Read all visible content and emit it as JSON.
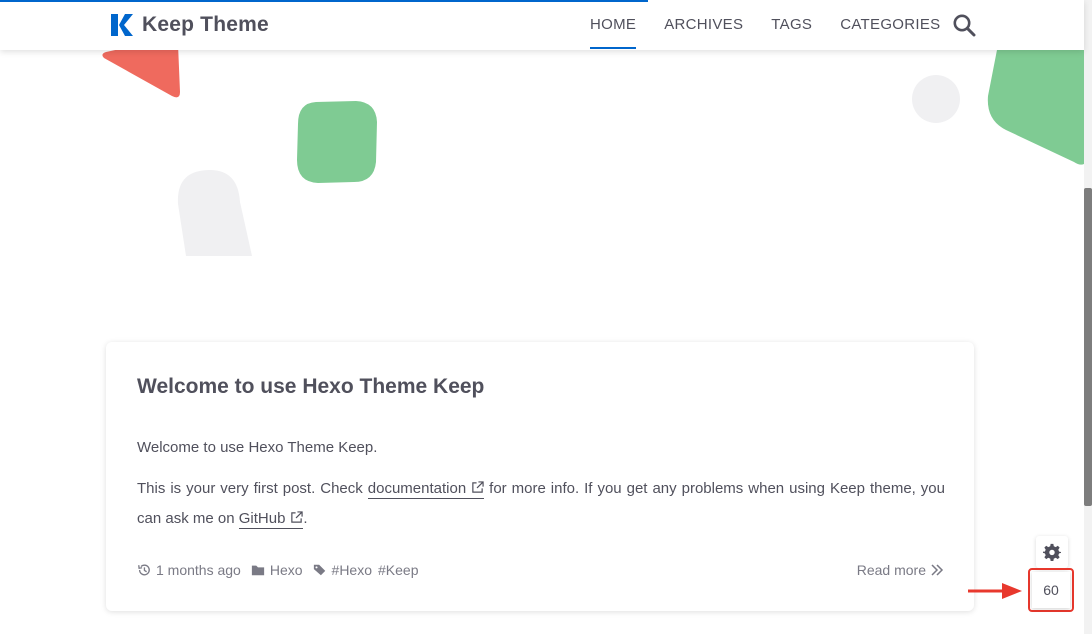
{
  "header": {
    "logo_text": "Keep Theme",
    "nav": [
      {
        "label": "HOME",
        "active": true
      },
      {
        "label": "ARCHIVES",
        "active": false
      },
      {
        "label": "TAGS",
        "active": false
      },
      {
        "label": "CATEGORIES",
        "active": false
      }
    ]
  },
  "post": {
    "title": "Welcome to use Hexo Theme Keep",
    "intro": "Welcome to use Hexo Theme Keep.",
    "line_part1": "This is your very first post. Check",
    "doc_link": "documentation",
    "line_part2": "for more info. If you get any problems when using Keep theme, you can ask me on",
    "github_link": "GitHub",
    "line_end": ".",
    "meta": {
      "time": "1 months ago",
      "category": "Hexo",
      "tags": [
        "#Hexo",
        "#Keep"
      ]
    },
    "read_more": "Read more"
  },
  "side_tools": {
    "counter_value": "60"
  },
  "icons": {
    "logo": "keep-logo-icon",
    "search": "search-icon",
    "gear": "gear-icon",
    "history": "history-icon",
    "folder": "folder-icon",
    "tags": "tags-icon",
    "external_link": "external-link-icon",
    "chevrons": "double-chevron-right-icon",
    "arrow": "red-arrow-icon"
  },
  "colors": {
    "accent": "#0066cc",
    "text": "#50505c",
    "highlight": "#e8382d"
  }
}
